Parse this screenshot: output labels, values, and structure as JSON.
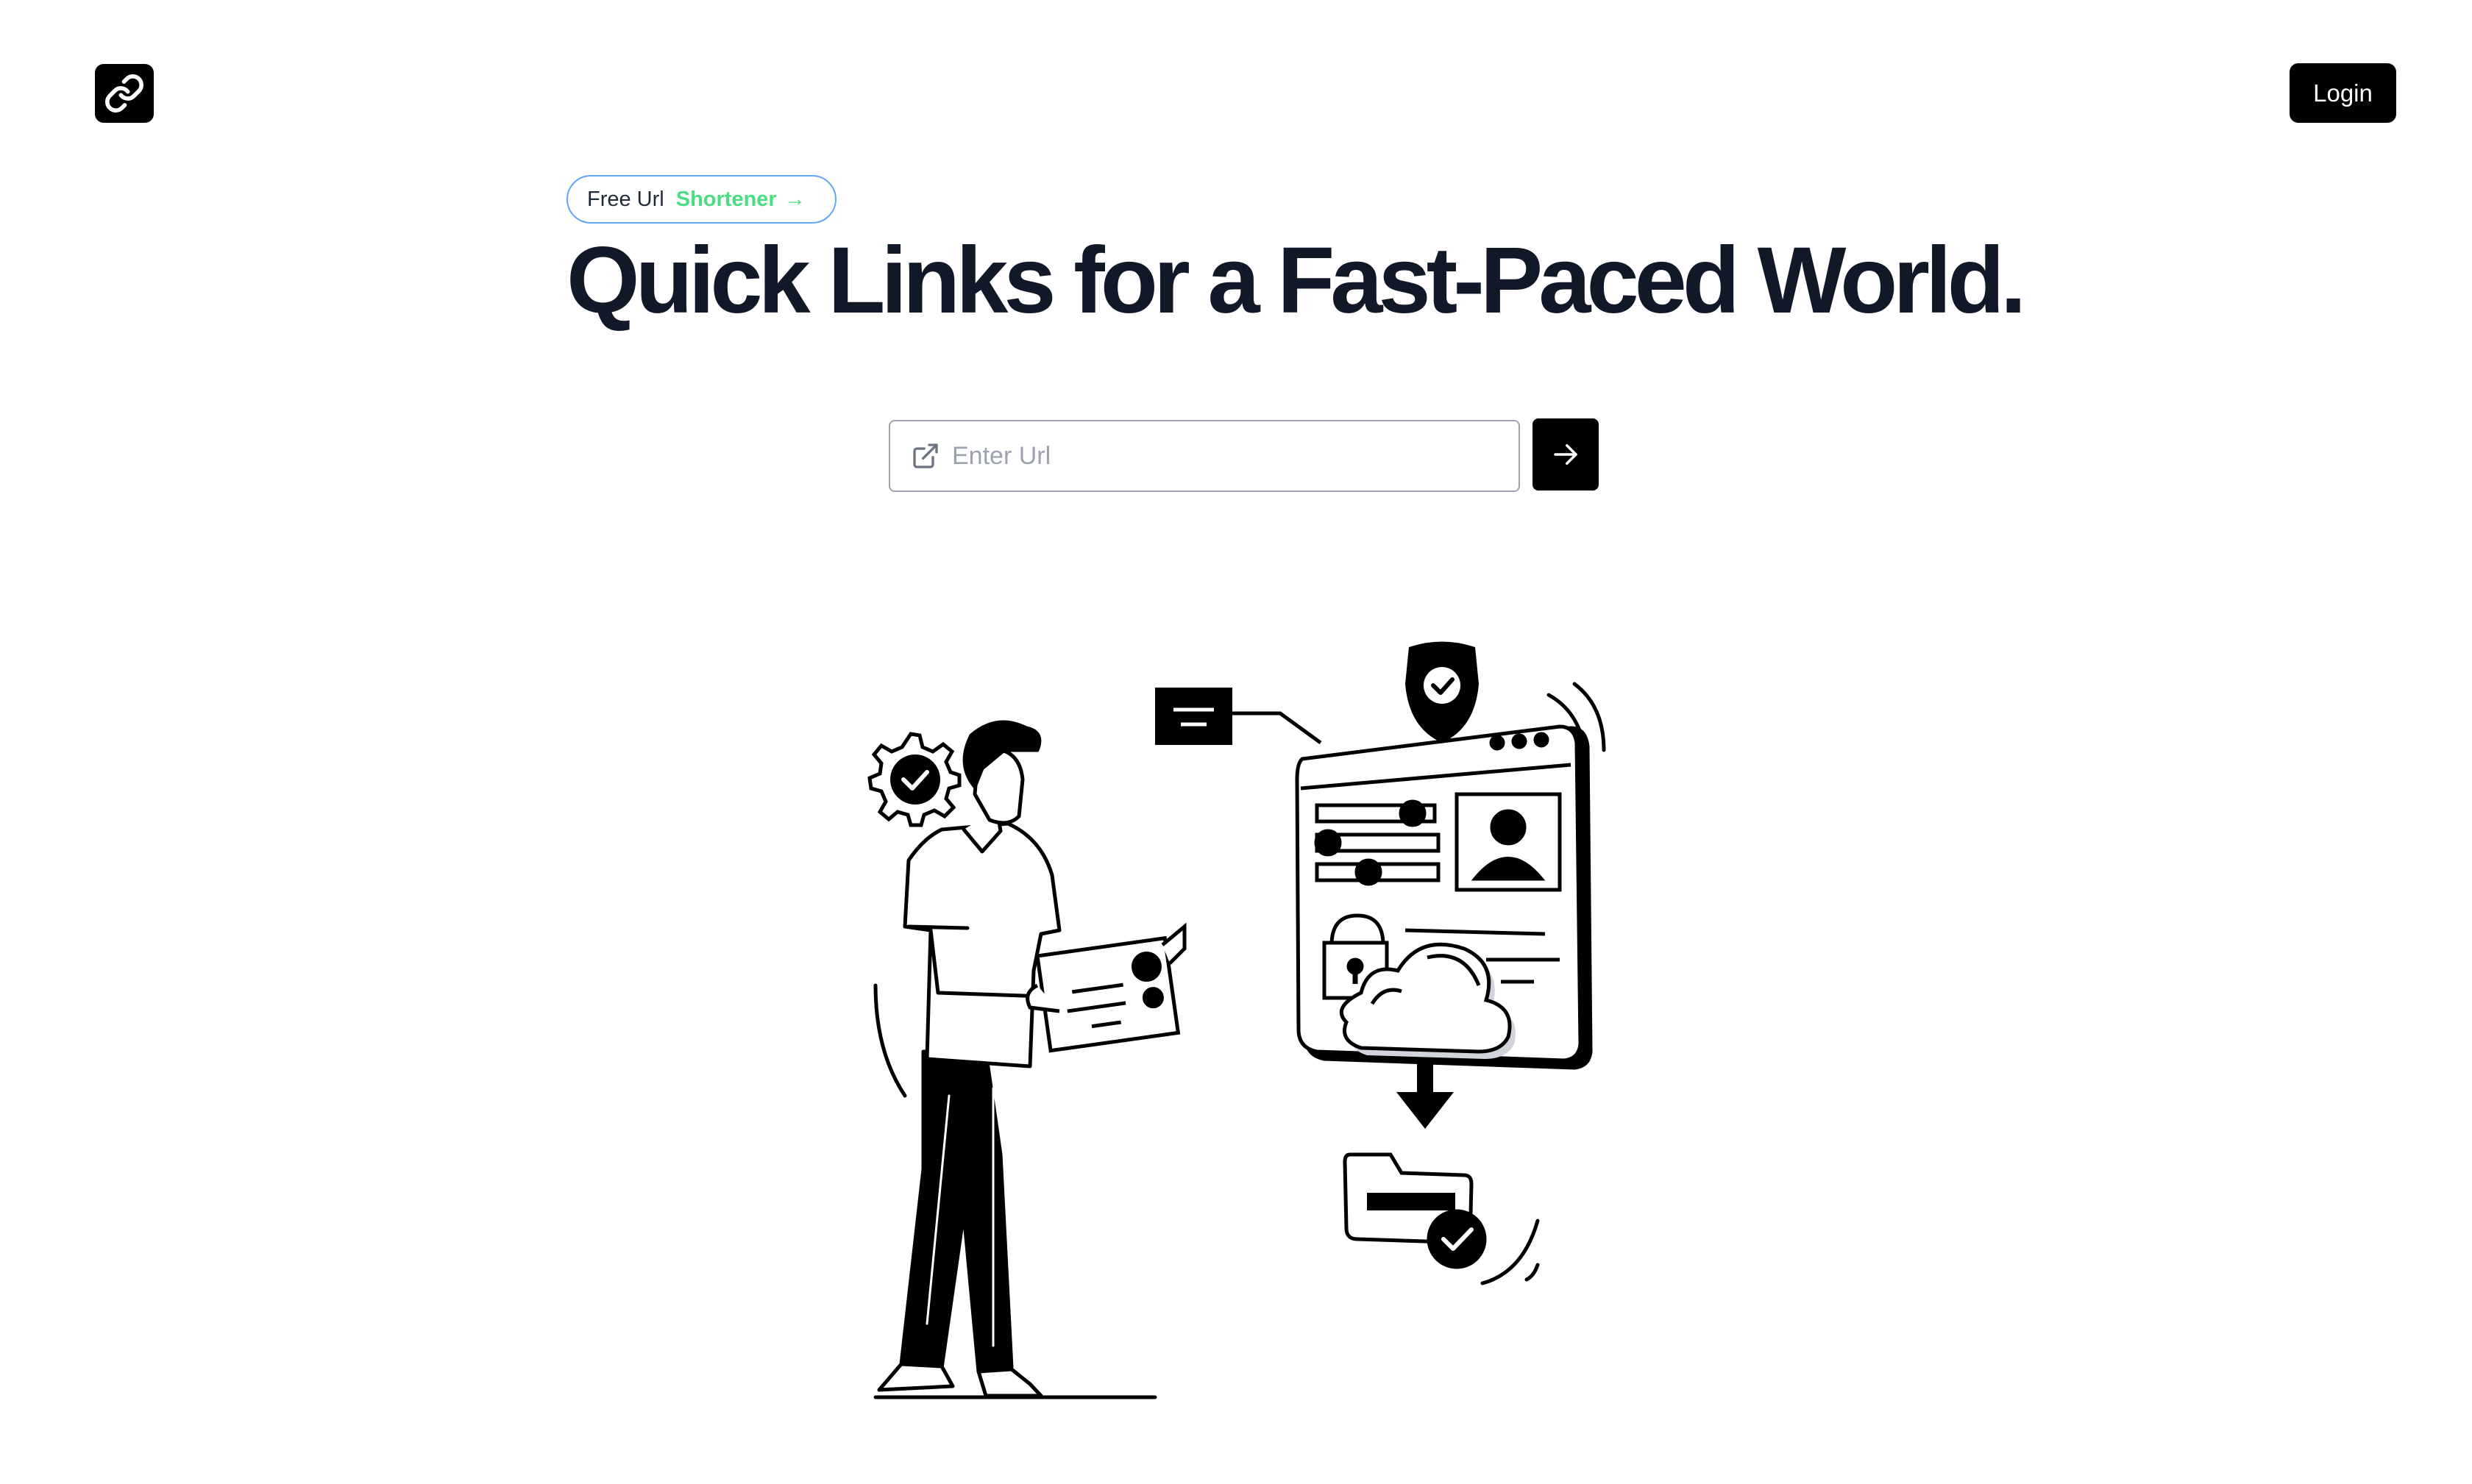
{
  "header": {
    "logo_icon": "link-icon",
    "login_label": "Login"
  },
  "hero": {
    "badge": {
      "text_primary": "Free Url",
      "text_accent": "Shortener",
      "arrow": "→",
      "accent_color": "#4ade80",
      "border_color": "#60a5fa"
    },
    "headline": "Quick Links for a Fast-Paced World."
  },
  "url_form": {
    "input_icon": "external-link-icon",
    "placeholder": "Enter Url",
    "value": "",
    "submit_icon": "arrow-right-icon"
  },
  "illustration": {
    "icons": [
      "gear-check-icon",
      "shield-check-icon",
      "lock-icon",
      "cloud-icon",
      "folder-icon",
      "user-avatar-icon",
      "message-icon"
    ]
  }
}
